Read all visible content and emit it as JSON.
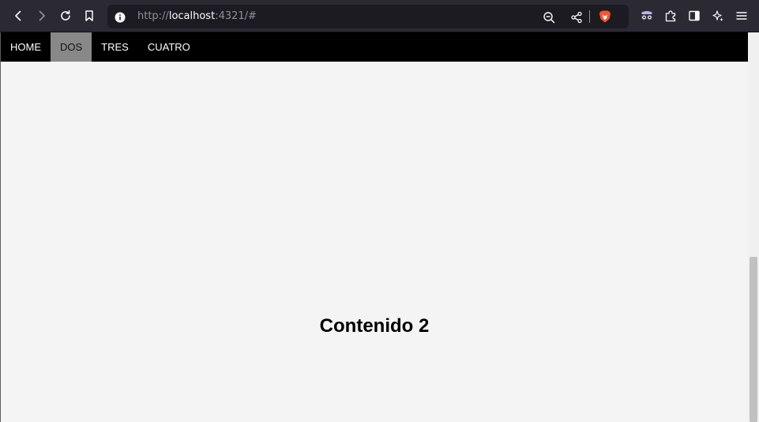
{
  "browser": {
    "url_scheme": "http://",
    "url_host": "localhost",
    "url_rest": ":4321/#",
    "icons": {
      "back": "arrow-left-icon",
      "forward": "arrow-right-icon",
      "reload": "reload-icon",
      "bookmark": "bookmark-icon",
      "site_info": "info-icon",
      "zoom": "zoom-out-icon",
      "share": "share-icon",
      "brave": "brave-lion-icon",
      "private": "private-window-icon",
      "extensions": "puzzle-icon",
      "sidebar": "sidebar-icon",
      "leo": "sparkle-icon",
      "menu": "hamburger-menu-icon"
    },
    "accent_brave": "#fb542b"
  },
  "nav": {
    "items": [
      {
        "label": "HOME"
      },
      {
        "label": "DOS"
      },
      {
        "label": "TRES"
      },
      {
        "label": "CUATRO"
      }
    ],
    "active_index": 1,
    "background": "#000000",
    "active_background": "#888888"
  },
  "main": {
    "title": "Contenido 2"
  }
}
